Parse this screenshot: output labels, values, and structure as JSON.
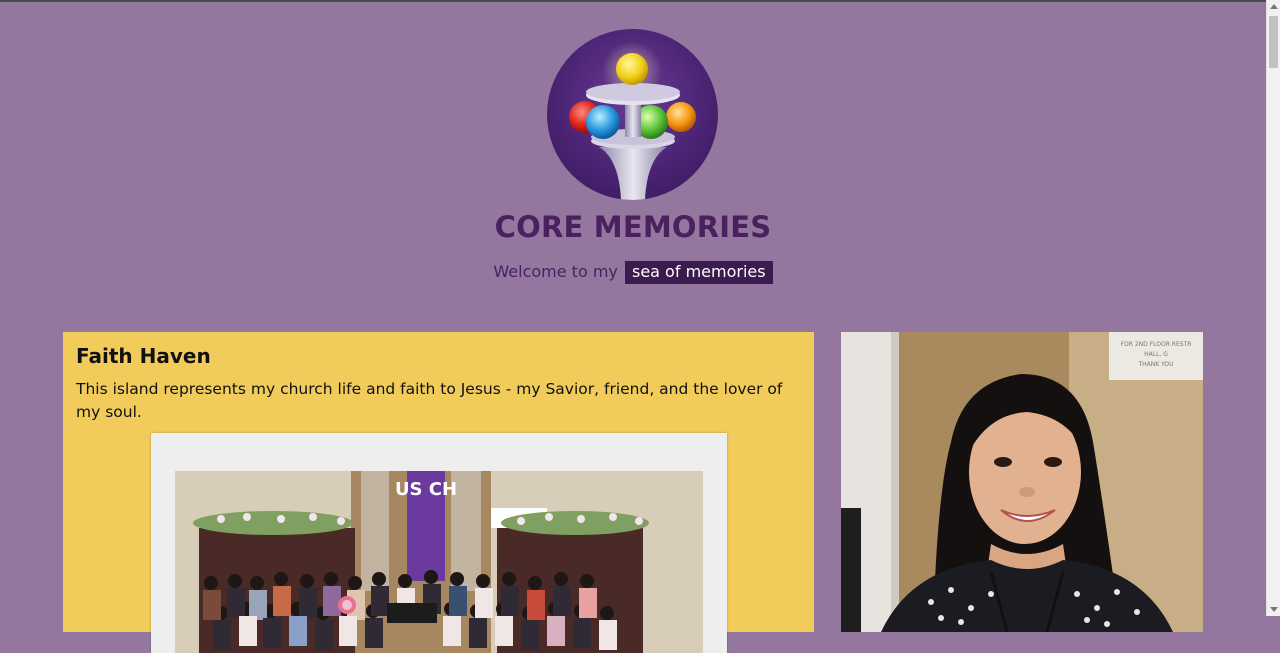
{
  "header": {
    "logo": "memory-orbs-logo",
    "title": "CORE MEMORIES",
    "welcome_prefix": "Welcome to my",
    "welcome_highlight": "sea of memories"
  },
  "sections": [
    {
      "title": "Faith Haven",
      "description": "This island represents my church life and faith to Jesus - my Savior, friend, and the lover of my soul.",
      "photo": "church-group-photo",
      "banner_text": "US CH"
    }
  ],
  "portrait": {
    "photo": "smiling-woman-portrait",
    "sign_text": [
      "FOR 2ND FLOOR RESTR",
      "HALL, G",
      "THANK YOU"
    ]
  },
  "colors": {
    "background": "#93779f",
    "title": "#4a215e",
    "highlight_bg": "#3c1c4e",
    "card": "#f1cc5a"
  }
}
